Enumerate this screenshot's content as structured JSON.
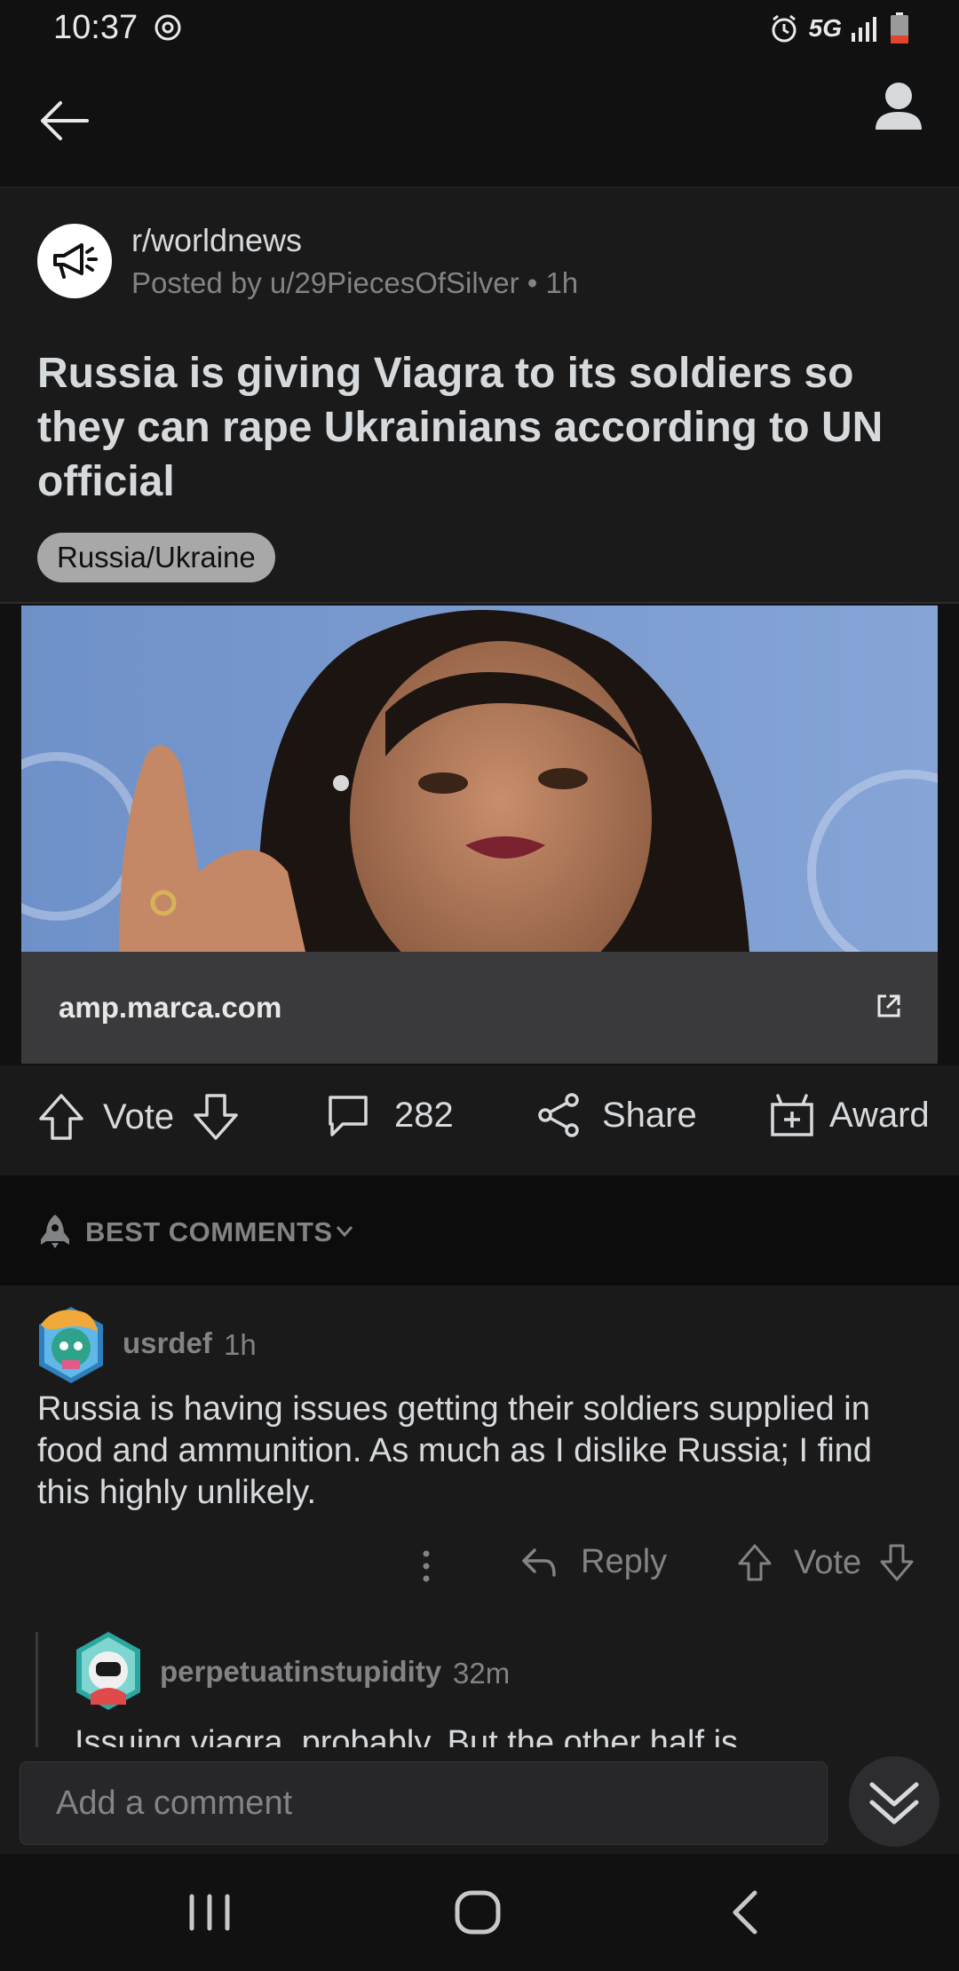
{
  "status": {
    "time": "10:37",
    "network": "5G"
  },
  "post": {
    "subreddit": "r/worldnews",
    "meta": "Posted by u/29PiecesOfSilver • 1h",
    "title": "Russia is giving Viagra to its soldiers so they can rape Ukrainians according to UN official",
    "flair": "Russia/Ukraine",
    "link_domain": "amp.marca.com"
  },
  "actions": {
    "vote_label": "Vote",
    "comment_count": "282",
    "share_label": "Share",
    "award_label": "Award"
  },
  "sort": {
    "label": "BEST COMMENTS"
  },
  "comments": [
    {
      "user": "usrdef",
      "time": "1h",
      "body": "Russia is having issues getting their soldiers supplied in food and ammunition. As much as I dislike Russia; I find this highly unlikely.",
      "reply_label": "Reply",
      "vote_label": "Vote"
    },
    {
      "user": "perpetuatinstupidity",
      "time": "32m",
      "body": "Issuing viagra, probably. But the other half is"
    }
  ],
  "composer": {
    "placeholder": "Add a comment"
  },
  "colors": {
    "background": "#1a1a1b",
    "text": "#d7dadc",
    "muted": "#818384",
    "flair": "#a8a8a8"
  }
}
